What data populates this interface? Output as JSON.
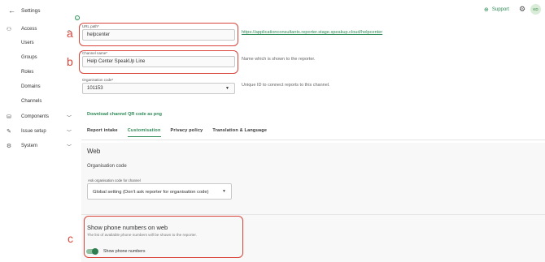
{
  "sidebar": {
    "title": "Settings",
    "items": [
      {
        "label": "Access",
        "icon": "people-icon"
      },
      {
        "label": "Users"
      },
      {
        "label": "Groups"
      },
      {
        "label": "Roles"
      },
      {
        "label": "Domains"
      },
      {
        "label": "Channels"
      },
      {
        "label": "Components",
        "icon": "database-icon"
      },
      {
        "label": "Issue setup",
        "icon": "tools-icon"
      },
      {
        "label": "System",
        "icon": "gear-icon"
      }
    ]
  },
  "topbar": {
    "support_label": "Support",
    "avatar_initials": "KD"
  },
  "form": {
    "url_path": {
      "label": "URL path*",
      "value": "helpcenter",
      "link": "https://applicationconsultants.reporter.stage.speakup.cloud/helpcenter"
    },
    "channel_name": {
      "label": "Channel name*",
      "value": "Help Center SpeakUp Line",
      "hint": "Name which is shown to the reporter."
    },
    "org_code": {
      "label": "Organisation code*",
      "value": "101153",
      "hint": "Unique ID to connect reports to this channel."
    },
    "qr_label": "Download channel QR code as png"
  },
  "annotations": {
    "a": "a",
    "b": "b",
    "c": "c"
  },
  "tabs": [
    "Report intake",
    "Customisation",
    "Privacy policy",
    "Translation & Language"
  ],
  "panel": {
    "title": "Web",
    "section": "Organisation code",
    "select_label": "Ask organisation code for channel",
    "select_value": "Global setting (Don't ask reporter for organisation code)",
    "phone_title": "Show phone numbers on web",
    "phone_sub": "The list of available phone numbers will be shown to the reporter.",
    "toggle_label": "Show phone numbers"
  },
  "colors": {
    "accent": "#2e8b57",
    "annotation": "#d9453a"
  }
}
